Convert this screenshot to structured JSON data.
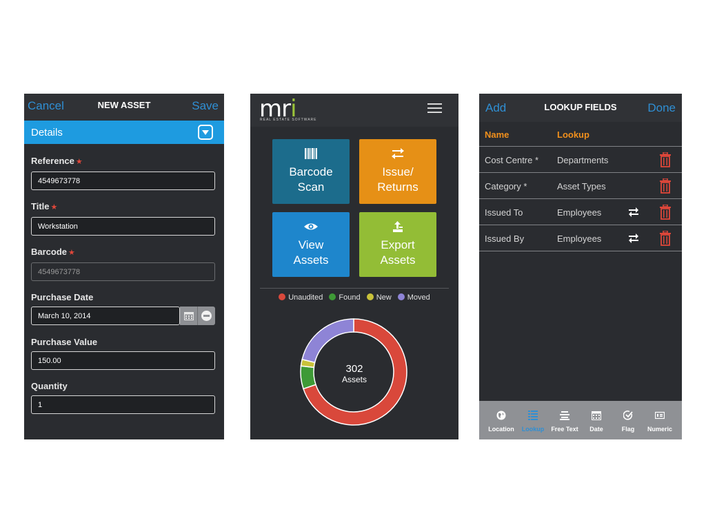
{
  "new_asset": {
    "nav": {
      "cancel": "Cancel",
      "title": "NEW ASSET",
      "save": "Save"
    },
    "section": "Details",
    "fields": {
      "reference": {
        "label": "Reference",
        "value": "4549673778"
      },
      "title": {
        "label": "Title",
        "value": "Workstation"
      },
      "barcode": {
        "label": "Barcode",
        "value": "4549673778"
      },
      "purchase_date": {
        "label": "Purchase Date",
        "value": "March 10, 2014"
      },
      "purchase_value": {
        "label": "Purchase Value",
        "value": "150.00"
      },
      "quantity": {
        "label": "Quantity",
        "value": "1"
      }
    },
    "required_mark": "★",
    "colors": {
      "link": "#2f8fd4",
      "section_bar": "#1e9be0",
      "required": "#e0473a"
    }
  },
  "dashboard": {
    "logo": {
      "text": "mr",
      "accent": "i",
      "subtitle": "REAL ESTATE SOFTWARE"
    },
    "icons": {
      "menu": "hamburger-menu-icon"
    },
    "tiles": {
      "barcode": {
        "line1": "Barcode",
        "line2": "Scan",
        "icon": "barcode-icon",
        "color": "#1c6c8c"
      },
      "issue": {
        "line1": "Issue/",
        "line2": "Returns",
        "icon": "swap-arrows-icon",
        "color": "#e69016"
      },
      "view": {
        "line1": "View",
        "line2": "Assets",
        "icon": "eye-icon",
        "color": "#1e86cc"
      },
      "export": {
        "line1": "Export",
        "line2": "Assets",
        "icon": "export-icon",
        "color": "#93bd36"
      }
    },
    "chart_data": {
      "type": "pie",
      "donut": true,
      "legend_position": "top",
      "center_value": "302",
      "center_label": "Assets",
      "total": 302,
      "series": [
        {
          "name": "Unaudited",
          "value": 211,
          "color": "#d9483b"
        },
        {
          "name": "Found",
          "value": 21,
          "color": "#3e9a36"
        },
        {
          "name": "New",
          "value": 6,
          "color": "#c9c23a"
        },
        {
          "name": "Moved",
          "value": 64,
          "color": "#8e84d6"
        }
      ]
    }
  },
  "lookup_fields": {
    "nav": {
      "add": "Add",
      "title": "LOOKUP FIELDS",
      "done": "Done"
    },
    "columns": {
      "name": "Name",
      "lookup": "Lookup"
    },
    "rows": [
      {
        "name": "Cost Centre *",
        "lookup": "Departments",
        "swap": false
      },
      {
        "name": "Category *",
        "lookup": "Asset Types",
        "swap": false
      },
      {
        "name": "Issued To",
        "lookup": "Employees",
        "swap": true
      },
      {
        "name": "Issued By",
        "lookup": "Employees",
        "swap": true
      }
    ],
    "tabs": [
      {
        "label": "Location",
        "icon": "globe-icon",
        "active": false
      },
      {
        "label": "Lookup",
        "icon": "list-icon",
        "active": true
      },
      {
        "label": "Free Text",
        "icon": "text-lines-icon",
        "active": false
      },
      {
        "label": "Date",
        "icon": "calendar-icon",
        "active": false
      },
      {
        "label": "Flag",
        "icon": "check-circle-icon",
        "active": false
      },
      {
        "label": "Numeric",
        "icon": "numeric-icon",
        "active": false
      }
    ],
    "colors": {
      "header": "#f2901c",
      "trash": "#e0473a",
      "active_tab": "#2f8fd4"
    }
  }
}
